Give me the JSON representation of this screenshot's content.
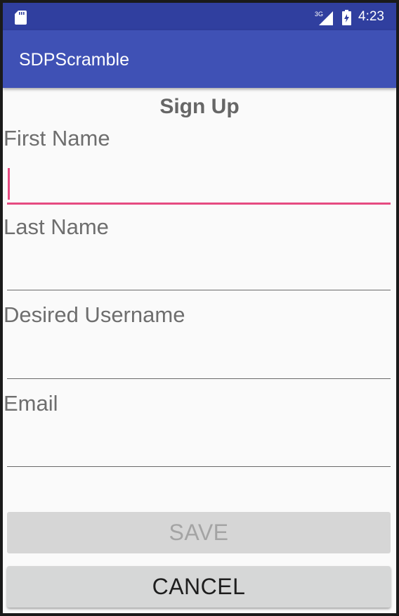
{
  "status_bar": {
    "time": "4:23",
    "network_label": "3G",
    "icons": [
      "sd-card-icon",
      "signal-3g-icon",
      "battery-icon"
    ]
  },
  "app_bar": {
    "title": "SDPScramble"
  },
  "form": {
    "title": "Sign Up",
    "fields": [
      {
        "label": "First Name",
        "value": ""
      },
      {
        "label": "Last Name",
        "value": ""
      },
      {
        "label": "Desired Username",
        "value": ""
      },
      {
        "label": "Email",
        "value": ""
      }
    ]
  },
  "buttons": {
    "save_label": "SAVE",
    "cancel_label": "CANCEL"
  },
  "colors": {
    "status_bar": "#303f9f",
    "app_bar": "#3f51b5",
    "accent": "#e64b81",
    "background": "#fafafa"
  }
}
